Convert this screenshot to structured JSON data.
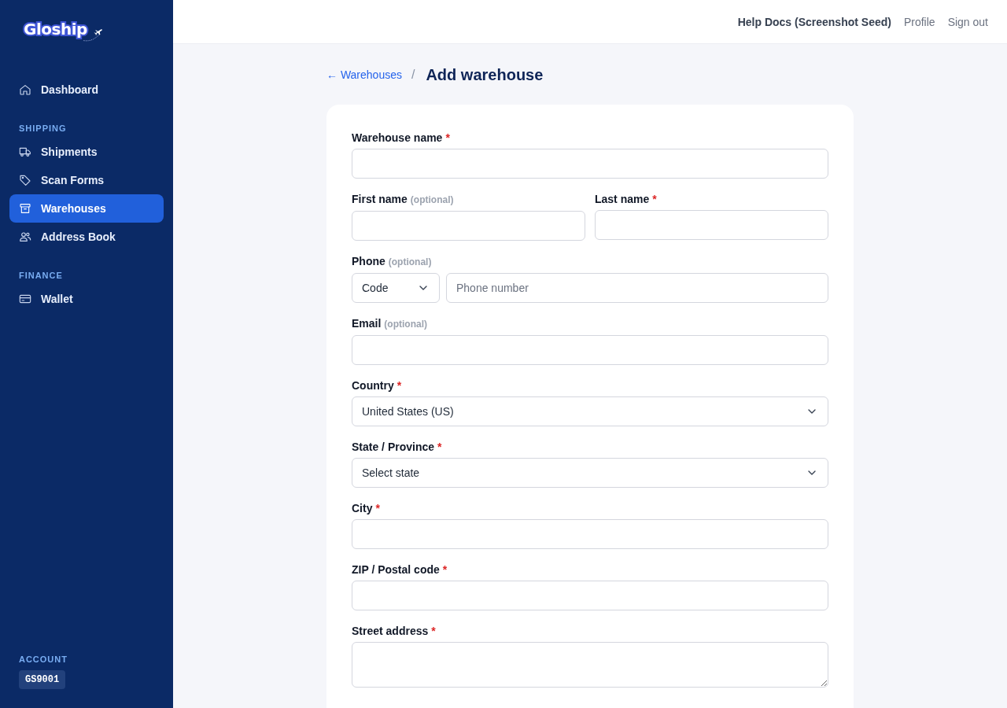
{
  "sidebar": {
    "logo": "Gloship",
    "sections": [
      {
        "items": [
          {
            "label": "Dashboard",
            "selected": false
          }
        ]
      },
      {
        "heading": "SHIPPING",
        "items": [
          {
            "label": "Shipments",
            "selected": false
          },
          {
            "label": "Scan Forms",
            "selected": false
          },
          {
            "label": "Warehouses",
            "selected": true
          },
          {
            "label": "Address Book",
            "selected": false
          }
        ]
      },
      {
        "heading": "FINANCE",
        "items": [
          {
            "label": "Wallet",
            "selected": false
          }
        ]
      }
    ],
    "account": {
      "heading": "ACCOUNT",
      "id": "GS9001"
    }
  },
  "top_bar": {
    "user": "Help Docs (Screenshot Seed)",
    "links": [
      "Profile",
      "Sign out"
    ]
  },
  "breadcrumb": {
    "back": "← Warehouses",
    "separator": "/",
    "title": "Add warehouse"
  },
  "form": {
    "rows": [
      {
        "fields": [
          {
            "kind": "text",
            "label": "Warehouse name",
            "required_mark": "*"
          }
        ]
      },
      {
        "fields": [
          {
            "kind": "text",
            "label": "First name",
            "optional_note": "(optional)"
          },
          {
            "kind": "text",
            "label": "Last name",
            "required_mark": "*"
          }
        ]
      },
      {
        "fields": [
          {
            "kind": "phone",
            "label": "Phone",
            "optional_note": "(optional)",
            "code": "Code",
            "placeholder": "Phone number"
          }
        ]
      },
      {
        "fields": [
          {
            "kind": "text",
            "label": "Email",
            "optional_note": "(optional)"
          }
        ]
      },
      {
        "fields": [
          {
            "kind": "select",
            "label": "Country",
            "required_mark": "*",
            "value": "United States (US)"
          }
        ]
      },
      {
        "fields": [
          {
            "kind": "select",
            "label": "State / Province",
            "required_mark": "*",
            "value": "Select state"
          }
        ]
      },
      {
        "fields": [
          {
            "kind": "text",
            "label": "City",
            "required_mark": "*"
          }
        ]
      },
      {
        "fields": [
          {
            "kind": "text",
            "label": "ZIP / Postal code",
            "required_mark": "*"
          }
        ]
      },
      {
        "fields": [
          {
            "kind": "textarea",
            "label": "Street address",
            "required_mark": "*"
          }
        ]
      }
    ]
  }
}
